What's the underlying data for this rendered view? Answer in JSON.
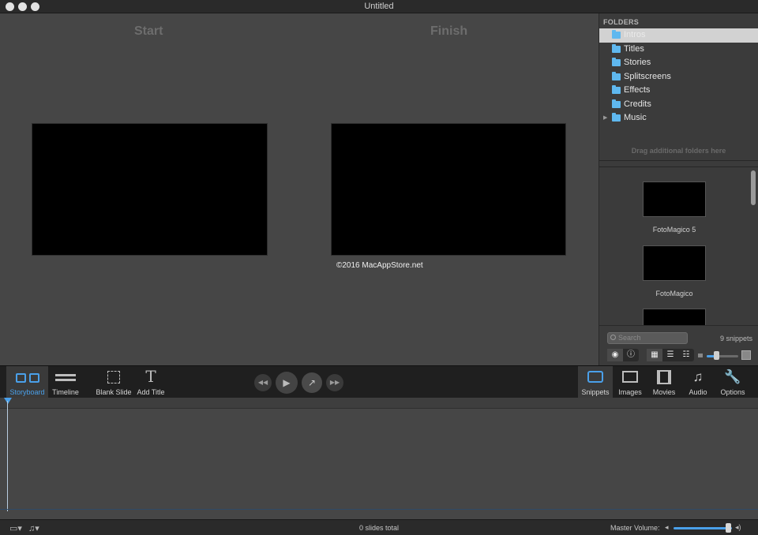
{
  "window": {
    "title": "Untitled"
  },
  "stage": {
    "start_label": "Start",
    "finish_label": "Finish",
    "watermark": "©2016 MacAppStore.net"
  },
  "folders": {
    "header": "FOLDERS",
    "items": [
      {
        "label": "Intros",
        "selected": true
      },
      {
        "label": "Titles"
      },
      {
        "label": "Stories"
      },
      {
        "label": "Splitscreens"
      },
      {
        "label": "Effects"
      },
      {
        "label": "Credits"
      },
      {
        "label": "Music",
        "collapsed": true
      }
    ],
    "drag_hint": "Drag additional folders here"
  },
  "snippets": {
    "items": [
      {
        "label": "FotoMagico 5"
      },
      {
        "label": "FotoMagico"
      }
    ],
    "search_placeholder": "Search",
    "count": "9 snippets"
  },
  "toolbar": {
    "storyboard": "Storyboard",
    "timeline": "Timeline",
    "blank_slide": "Blank Slide",
    "add_title": "Add Title",
    "snippets": "Snippets",
    "images": "Images",
    "movies": "Movies",
    "audio": "Audio",
    "options": "Options"
  },
  "status": {
    "slides_total": "0 slides total",
    "master_volume_label": "Master Volume:",
    "master_volume": 0.95
  },
  "colors": {
    "accent": "#4aa0ea",
    "folder_icon": "#5fb8ef"
  }
}
